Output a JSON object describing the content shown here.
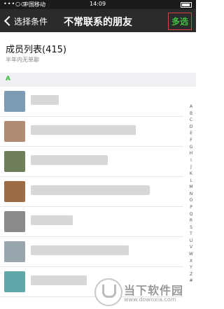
{
  "status_bar": {
    "signal": "•••○○",
    "carrier": "中国移动",
    "time": "14:09"
  },
  "nav": {
    "back_label": "选择条件",
    "title": "不常联系的朋友",
    "multi_select_label": "多选"
  },
  "header": {
    "title": "成员列表(415)",
    "subtitle": "半年内无单聊"
  },
  "section": {
    "letter": "A"
  },
  "contacts": [
    {
      "avatar_color": "#7d9bb5"
    },
    {
      "avatar_color": "#b08d72"
    },
    {
      "avatar_color": "#6e7f5a"
    },
    {
      "avatar_color": "#9c6d45"
    },
    {
      "avatar_color": "#8a8a8a"
    },
    {
      "avatar_color": "#9aa6ad"
    },
    {
      "avatar_color": "#5fa7a8"
    }
  ],
  "index_letters": [
    "A",
    "B",
    "C",
    "D",
    "E",
    "F",
    "G",
    "H",
    "I",
    "J",
    "K",
    "L",
    "M",
    "N",
    "O",
    "P",
    "Q",
    "R",
    "S",
    "T",
    "U",
    "V",
    "W",
    "X",
    "Y",
    "Z",
    "#"
  ],
  "watermark": {
    "name": "当下软件园",
    "url": "www.downxia.com"
  }
}
